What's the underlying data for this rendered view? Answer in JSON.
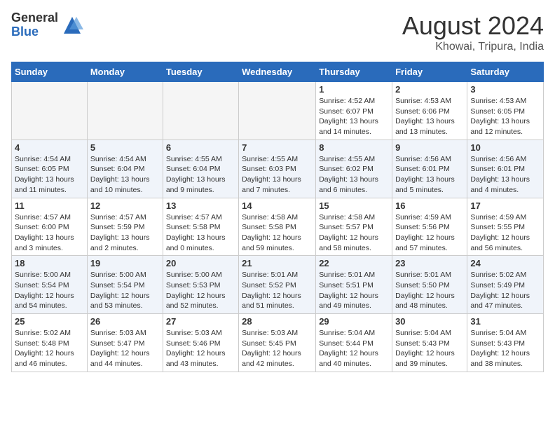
{
  "logo": {
    "general": "General",
    "blue": "Blue"
  },
  "title": "August 2024",
  "location": "Khowai, Tripura, India",
  "weekdays": [
    "Sunday",
    "Monday",
    "Tuesday",
    "Wednesday",
    "Thursday",
    "Friday",
    "Saturday"
  ],
  "weeks": [
    [
      {
        "day": "",
        "info": ""
      },
      {
        "day": "",
        "info": ""
      },
      {
        "day": "",
        "info": ""
      },
      {
        "day": "",
        "info": ""
      },
      {
        "day": "1",
        "info": "Sunrise: 4:52 AM\nSunset: 6:07 PM\nDaylight: 13 hours\nand 14 minutes."
      },
      {
        "day": "2",
        "info": "Sunrise: 4:53 AM\nSunset: 6:06 PM\nDaylight: 13 hours\nand 13 minutes."
      },
      {
        "day": "3",
        "info": "Sunrise: 4:53 AM\nSunset: 6:05 PM\nDaylight: 13 hours\nand 12 minutes."
      }
    ],
    [
      {
        "day": "4",
        "info": "Sunrise: 4:54 AM\nSunset: 6:05 PM\nDaylight: 13 hours\nand 11 minutes."
      },
      {
        "day": "5",
        "info": "Sunrise: 4:54 AM\nSunset: 6:04 PM\nDaylight: 13 hours\nand 10 minutes."
      },
      {
        "day": "6",
        "info": "Sunrise: 4:55 AM\nSunset: 6:04 PM\nDaylight: 13 hours\nand 9 minutes."
      },
      {
        "day": "7",
        "info": "Sunrise: 4:55 AM\nSunset: 6:03 PM\nDaylight: 13 hours\nand 7 minutes."
      },
      {
        "day": "8",
        "info": "Sunrise: 4:55 AM\nSunset: 6:02 PM\nDaylight: 13 hours\nand 6 minutes."
      },
      {
        "day": "9",
        "info": "Sunrise: 4:56 AM\nSunset: 6:01 PM\nDaylight: 13 hours\nand 5 minutes."
      },
      {
        "day": "10",
        "info": "Sunrise: 4:56 AM\nSunset: 6:01 PM\nDaylight: 13 hours\nand 4 minutes."
      }
    ],
    [
      {
        "day": "11",
        "info": "Sunrise: 4:57 AM\nSunset: 6:00 PM\nDaylight: 13 hours\nand 3 minutes."
      },
      {
        "day": "12",
        "info": "Sunrise: 4:57 AM\nSunset: 5:59 PM\nDaylight: 13 hours\nand 2 minutes."
      },
      {
        "day": "13",
        "info": "Sunrise: 4:57 AM\nSunset: 5:58 PM\nDaylight: 13 hours\nand 0 minutes."
      },
      {
        "day": "14",
        "info": "Sunrise: 4:58 AM\nSunset: 5:58 PM\nDaylight: 12 hours\nand 59 minutes."
      },
      {
        "day": "15",
        "info": "Sunrise: 4:58 AM\nSunset: 5:57 PM\nDaylight: 12 hours\nand 58 minutes."
      },
      {
        "day": "16",
        "info": "Sunrise: 4:59 AM\nSunset: 5:56 PM\nDaylight: 12 hours\nand 57 minutes."
      },
      {
        "day": "17",
        "info": "Sunrise: 4:59 AM\nSunset: 5:55 PM\nDaylight: 12 hours\nand 56 minutes."
      }
    ],
    [
      {
        "day": "18",
        "info": "Sunrise: 5:00 AM\nSunset: 5:54 PM\nDaylight: 12 hours\nand 54 minutes."
      },
      {
        "day": "19",
        "info": "Sunrise: 5:00 AM\nSunset: 5:54 PM\nDaylight: 12 hours\nand 53 minutes."
      },
      {
        "day": "20",
        "info": "Sunrise: 5:00 AM\nSunset: 5:53 PM\nDaylight: 12 hours\nand 52 minutes."
      },
      {
        "day": "21",
        "info": "Sunrise: 5:01 AM\nSunset: 5:52 PM\nDaylight: 12 hours\nand 51 minutes."
      },
      {
        "day": "22",
        "info": "Sunrise: 5:01 AM\nSunset: 5:51 PM\nDaylight: 12 hours\nand 49 minutes."
      },
      {
        "day": "23",
        "info": "Sunrise: 5:01 AM\nSunset: 5:50 PM\nDaylight: 12 hours\nand 48 minutes."
      },
      {
        "day": "24",
        "info": "Sunrise: 5:02 AM\nSunset: 5:49 PM\nDaylight: 12 hours\nand 47 minutes."
      }
    ],
    [
      {
        "day": "25",
        "info": "Sunrise: 5:02 AM\nSunset: 5:48 PM\nDaylight: 12 hours\nand 46 minutes."
      },
      {
        "day": "26",
        "info": "Sunrise: 5:03 AM\nSunset: 5:47 PM\nDaylight: 12 hours\nand 44 minutes."
      },
      {
        "day": "27",
        "info": "Sunrise: 5:03 AM\nSunset: 5:46 PM\nDaylight: 12 hours\nand 43 minutes."
      },
      {
        "day": "28",
        "info": "Sunrise: 5:03 AM\nSunset: 5:45 PM\nDaylight: 12 hours\nand 42 minutes."
      },
      {
        "day": "29",
        "info": "Sunrise: 5:04 AM\nSunset: 5:44 PM\nDaylight: 12 hours\nand 40 minutes."
      },
      {
        "day": "30",
        "info": "Sunrise: 5:04 AM\nSunset: 5:43 PM\nDaylight: 12 hours\nand 39 minutes."
      },
      {
        "day": "31",
        "info": "Sunrise: 5:04 AM\nSunset: 5:43 PM\nDaylight: 12 hours\nand 38 minutes."
      }
    ]
  ]
}
